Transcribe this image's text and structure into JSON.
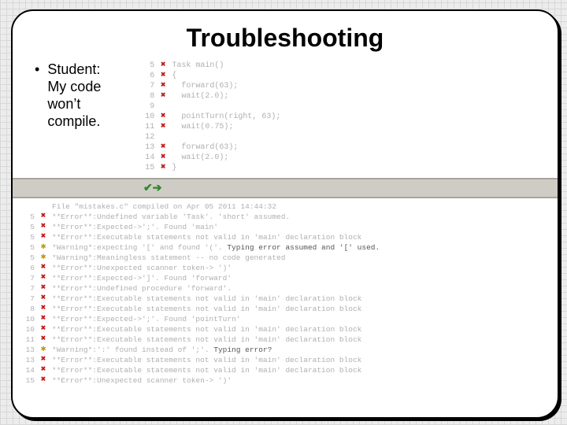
{
  "title": "Troubleshooting",
  "bullet": {
    "lead": "Student:",
    "sub1": "My code",
    "sub2": "won’t",
    "sub3": "compile."
  },
  "code": {
    "lines": [
      {
        "n": "5",
        "mark": "x",
        "text": "Task main()"
      },
      {
        "n": "6",
        "mark": "x",
        "text": "{"
      },
      {
        "n": "7",
        "mark": "x",
        "text": "  forward(63);"
      },
      {
        "n": "8",
        "mark": "x",
        "text": "  wait(2.0);"
      },
      {
        "n": "9",
        "mark": "",
        "text": ""
      },
      {
        "n": "10",
        "mark": "x",
        "text": "  pointTurn(right, 63);"
      },
      {
        "n": "11",
        "mark": "x",
        "text": "  wait(0.75);"
      },
      {
        "n": "12",
        "mark": "",
        "text": ""
      },
      {
        "n": "13",
        "mark": "x",
        "text": "  forward(63);"
      },
      {
        "n": "14",
        "mark": "x",
        "text": "  wait(2.0);"
      },
      {
        "n": "15",
        "mark": "x",
        "text": "}"
      }
    ]
  },
  "toolbar": {
    "tick": "✔➔"
  },
  "errors": {
    "header": "File \"mistakes.c\" compiled on Apr 05 2011 14:44:32",
    "rows": [
      {
        "n": "5",
        "mark": "err",
        "msg": "**Error**:Undefined variable 'Task'. 'short' assumed."
      },
      {
        "n": "5",
        "mark": "err",
        "msg": "**Error**:Expected->';'. Found 'main'"
      },
      {
        "n": "5",
        "mark": "err",
        "msg": "**Error**:Executable statements not valid in 'main' declaration block"
      },
      {
        "n": "5",
        "mark": "warn",
        "msg": "*Warning*:expecting '[' and found '('.",
        "extra": " Typing error assumed and '[' used."
      },
      {
        "n": "5",
        "mark": "warn",
        "msg": "*Warning*:Meaningless statement -- no code generated"
      },
      {
        "n": "6",
        "mark": "err",
        "msg": "**Error**:Unexpected scanner token-> ')'"
      },
      {
        "n": "7",
        "mark": "err",
        "msg": "**Error**:Expected->']'. Found 'forward'"
      },
      {
        "n": "7",
        "mark": "err",
        "msg": "**Error**:Undefined procedure 'forward'."
      },
      {
        "n": "7",
        "mark": "err",
        "msg": "**Error**:Executable statements not valid in 'main' declaration block"
      },
      {
        "n": "8",
        "mark": "err",
        "msg": "**Error**:Executable statements not valid in 'main' declaration block"
      },
      {
        "n": "10",
        "mark": "err",
        "msg": "**Error**:Expected->';'. Found 'pointTurn'"
      },
      {
        "n": "10",
        "mark": "err",
        "msg": "**Error**:Executable statements not valid in 'main' declaration block"
      },
      {
        "n": "11",
        "mark": "err",
        "msg": "**Error**:Executable statements not valid in 'main' declaration block"
      },
      {
        "n": "13",
        "mark": "warn",
        "msg": "*Warning*:':' found instead of ';'.",
        "extra": " Typing error?"
      },
      {
        "n": "13",
        "mark": "err",
        "msg": "**Error**:Executable statements not valid in 'main' declaration block"
      },
      {
        "n": "14",
        "mark": "err",
        "msg": "**Error**:Executable statements not valid in 'main' declaration block"
      },
      {
        "n": "15",
        "mark": "err",
        "msg": "**Error**:Unexpected scanner token-> ')'"
      }
    ]
  }
}
